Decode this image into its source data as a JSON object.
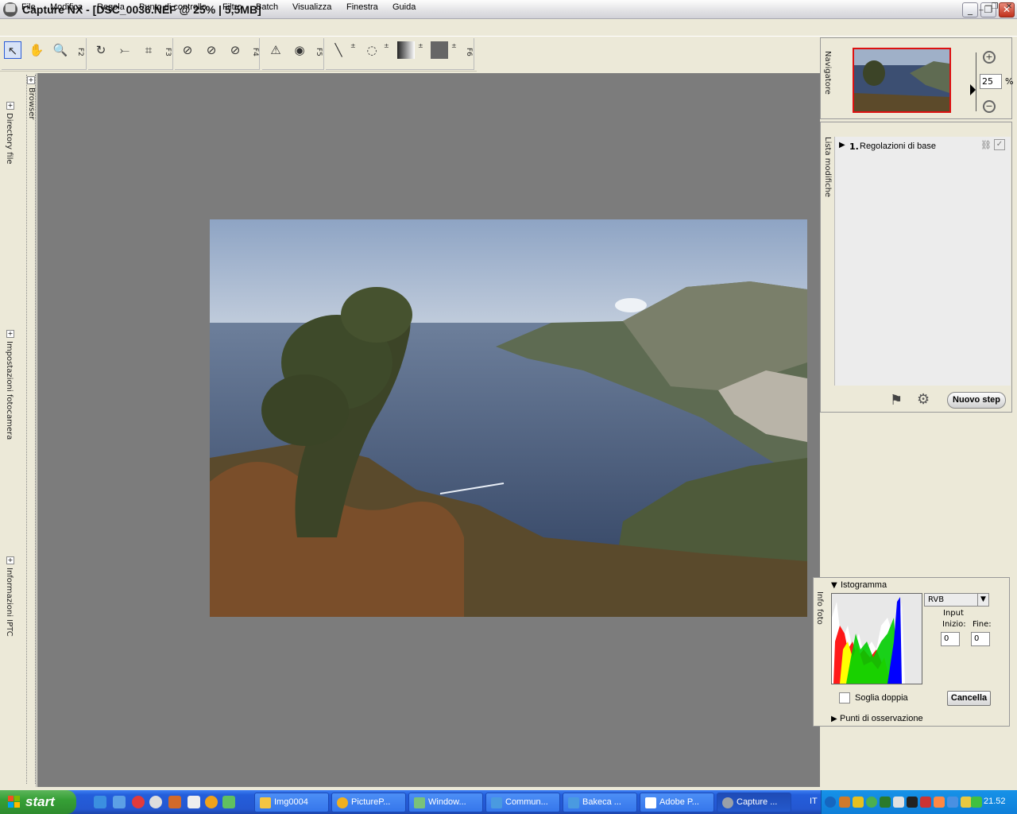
{
  "titlebar": {
    "title": "Capture NX - [DSC_0036.NEF @ 25% | 5,5MB]",
    "logo_text": "NX"
  },
  "menu": {
    "items": [
      "File",
      "Modifica",
      "Regola",
      "Punto di controllo",
      "Filtro",
      "Batch",
      "Visualizza",
      "Finestra",
      "Guida"
    ]
  },
  "toolbar": {
    "group_labels": [
      "F2",
      "F3",
      "F4",
      "F5",
      "F6"
    ]
  },
  "left_panel": {
    "browser": "Browser",
    "directory": "Directory file",
    "camera_settings": "Impostazioni fotocamera",
    "iptc": "Informazioni IPTC"
  },
  "navigator": {
    "title": "Navigatore",
    "zoom_value": "25",
    "zoom_unit": "%"
  },
  "edit_list": {
    "title": "Lista modifiche",
    "step_number": "1.",
    "step_label": "Regolazioni di base",
    "new_step_label": "Nuovo step"
  },
  "info_panel": {
    "title": "Info foto",
    "histogram_label": "Istogramma",
    "channel": "RVB",
    "input_label": "Input",
    "start_label": "Inizio:",
    "end_label": "Fine:",
    "start_value": "0",
    "end_value": "0",
    "double_threshold_label": "Soglia doppia",
    "cancel_label": "Cancella",
    "watch_points_label": "Punti di osservazione"
  },
  "taskbar": {
    "start_label": "start",
    "tasks": [
      {
        "label": "Img0004",
        "color": "#f5c542"
      },
      {
        "label": "PictureP...",
        "color": "#f0b020"
      },
      {
        "label": "Window...",
        "color": "#7ac27a"
      },
      {
        "label": "Commun...",
        "color": "#4a9ae0"
      },
      {
        "label": "Bakeca ...",
        "color": "#4a9ae0"
      },
      {
        "label": "Adobe P...",
        "color": "#ffffff"
      },
      {
        "label": "Capture ...",
        "color": "#9aa0a8"
      }
    ],
    "language": "IT",
    "clock": "21.52"
  }
}
